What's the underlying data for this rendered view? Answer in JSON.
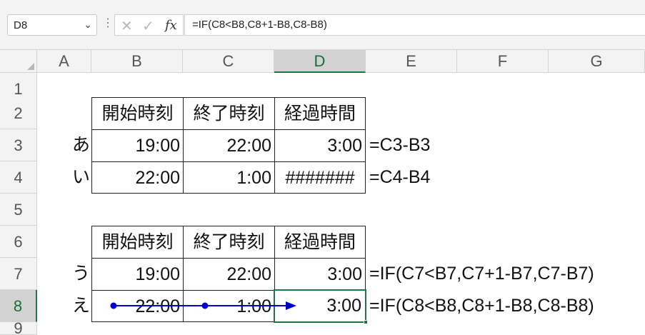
{
  "formula_bar": {
    "name_box": "D8",
    "formula": "=IF(C8<B8,C8+1-B8,C8-B8)"
  },
  "columns": [
    "A",
    "B",
    "C",
    "D",
    "E",
    "F",
    "G"
  ],
  "rows": [
    "1",
    "2",
    "3",
    "4",
    "5",
    "6",
    "7",
    "8",
    "9"
  ],
  "table1": {
    "headers": [
      "開始時刻",
      "終了時刻",
      "経過時間"
    ],
    "rows": [
      {
        "label": "あ",
        "start": "19:00",
        "end": "22:00",
        "elapsed": "3:00",
        "note": "=C3-B3"
      },
      {
        "label": "い",
        "start": "22:00",
        "end": "1:00",
        "elapsed": "#######",
        "note": "=C4-B4"
      }
    ]
  },
  "table2": {
    "headers": [
      "開始時刻",
      "終了時刻",
      "経過時間"
    ],
    "rows": [
      {
        "label": "う",
        "start": "19:00",
        "end": "22:00",
        "elapsed": "3:00",
        "note": "=IF(C7<B7,C7+1-B7,C7-B7)"
      },
      {
        "label": "え",
        "start": "22:00",
        "end": "1:00",
        "elapsed": "3:00",
        "note": "=IF(C8<B8,C8+1-B8,C8-B8)"
      }
    ]
  },
  "colors": {
    "selection": "#217346",
    "trace_arrow": "#0000cc"
  }
}
